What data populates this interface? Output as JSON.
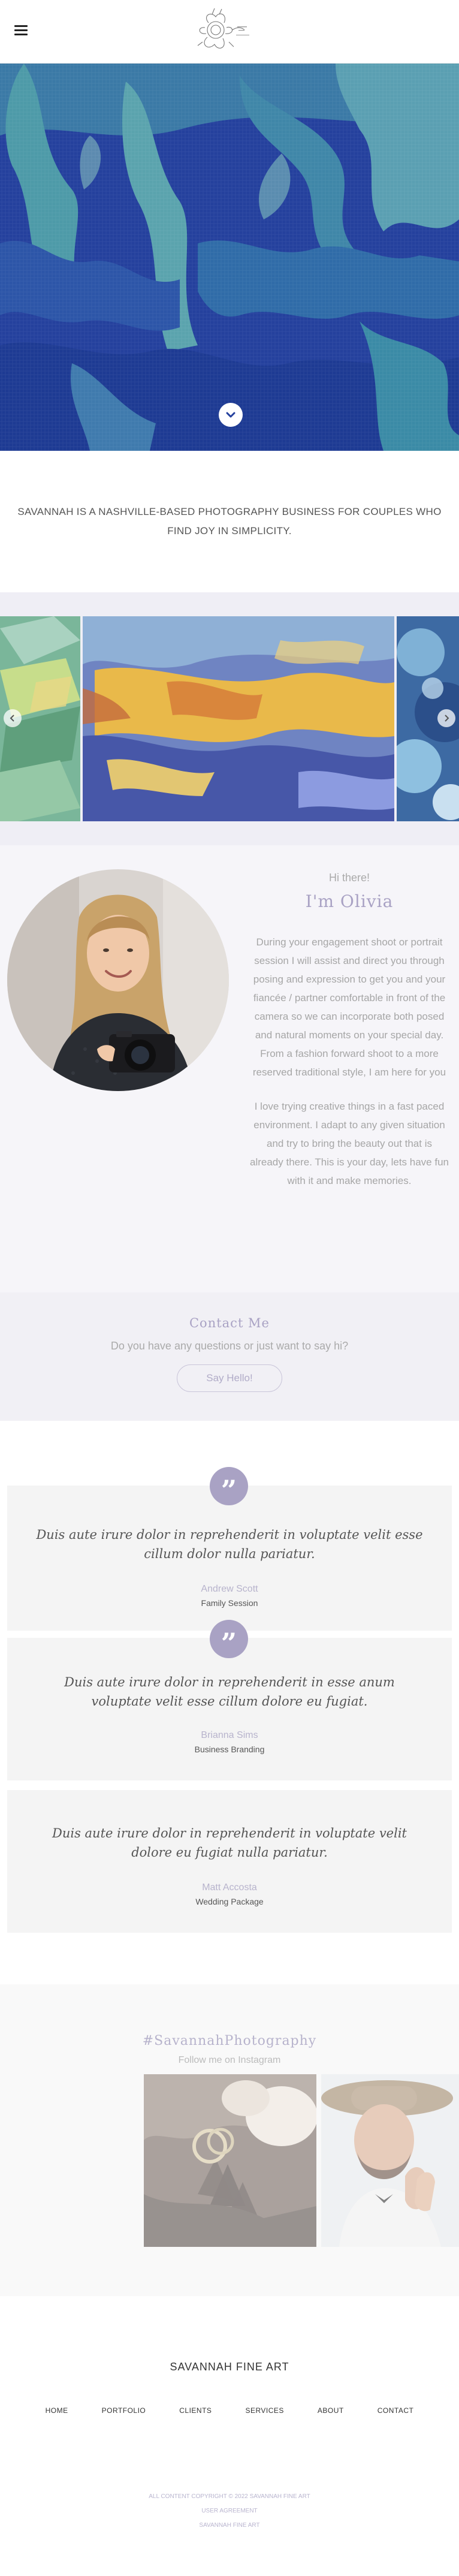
{
  "header": {
    "logo_icon": "floral-logo-icon",
    "menu_icon": "hamburger-menu-icon"
  },
  "hero": {
    "scroll_icon": "chevron-down-icon"
  },
  "intro": {
    "text": "SAVANNAH IS A NASHVILLE-BASED PHOTOGRAPHY BUSINESS FOR COUPLES WHO FIND JOY IN SIMPLICITY."
  },
  "gallery": {
    "prev_icon": "chevron-left-icon",
    "next_icon": "chevron-right-icon"
  },
  "about": {
    "greeting": "Hi there!",
    "title": "I'm Olivia",
    "paragraph1": "During your engagement shoot or portrait session I will assist and direct you through posing and expression to get you and your fiancée / partner comfortable in front of the camera so we can incorporate both posed and natural moments on your special day. From a fashion forward shoot to a more reserved traditional style, I am here for you",
    "paragraph2": "I love trying creative things in a fast paced environment. I adapt to any given situation and try to bring the beauty out that is already there. This is your day, lets have fun with it and make memories."
  },
  "contact": {
    "title": "Contact Me",
    "question": "Do you have any questions or just want to say hi?",
    "button": "Say Hello!"
  },
  "testimonials": [
    {
      "quote": "Duis aute irure dolor in reprehenderit in voluptate velit esse cillum dolor nulla pariatur.",
      "name": "Andrew Scott",
      "role": "Family Session"
    },
    {
      "quote": "Duis aute irure dolor in reprehenderit in esse anum voluptate velit esse cillum dolore eu fugiat.",
      "name": "Brianna Sims",
      "role": "Business Branding"
    },
    {
      "quote": "Duis aute irure dolor in reprehenderit in voluptate velit dolore eu fugiat nulla pariatur.",
      "name": "Matt Accosta",
      "role": "Wedding Package"
    }
  ],
  "testimonial_badge": "”",
  "instagram": {
    "title": "#SavannahPhotography",
    "subtitle": "Follow me on Instagram"
  },
  "footer": {
    "brand": "SAVANNAH FINE ART",
    "nav": [
      "HOME",
      "PORTFOLIO",
      "CLIENTS",
      "SERVICES",
      "ABOUT",
      "CONTACT"
    ],
    "copyright": "ALL CONTENT COPYRIGHT © 2022 SAVANNAH FINE ART",
    "link1": "USER AGREEMENT",
    "link2": "SAVANNAH FINE ART"
  },
  "colors": {
    "accent": "#a9a2c4",
    "band": "#efeef5",
    "hero_blue": "#243f9c"
  }
}
